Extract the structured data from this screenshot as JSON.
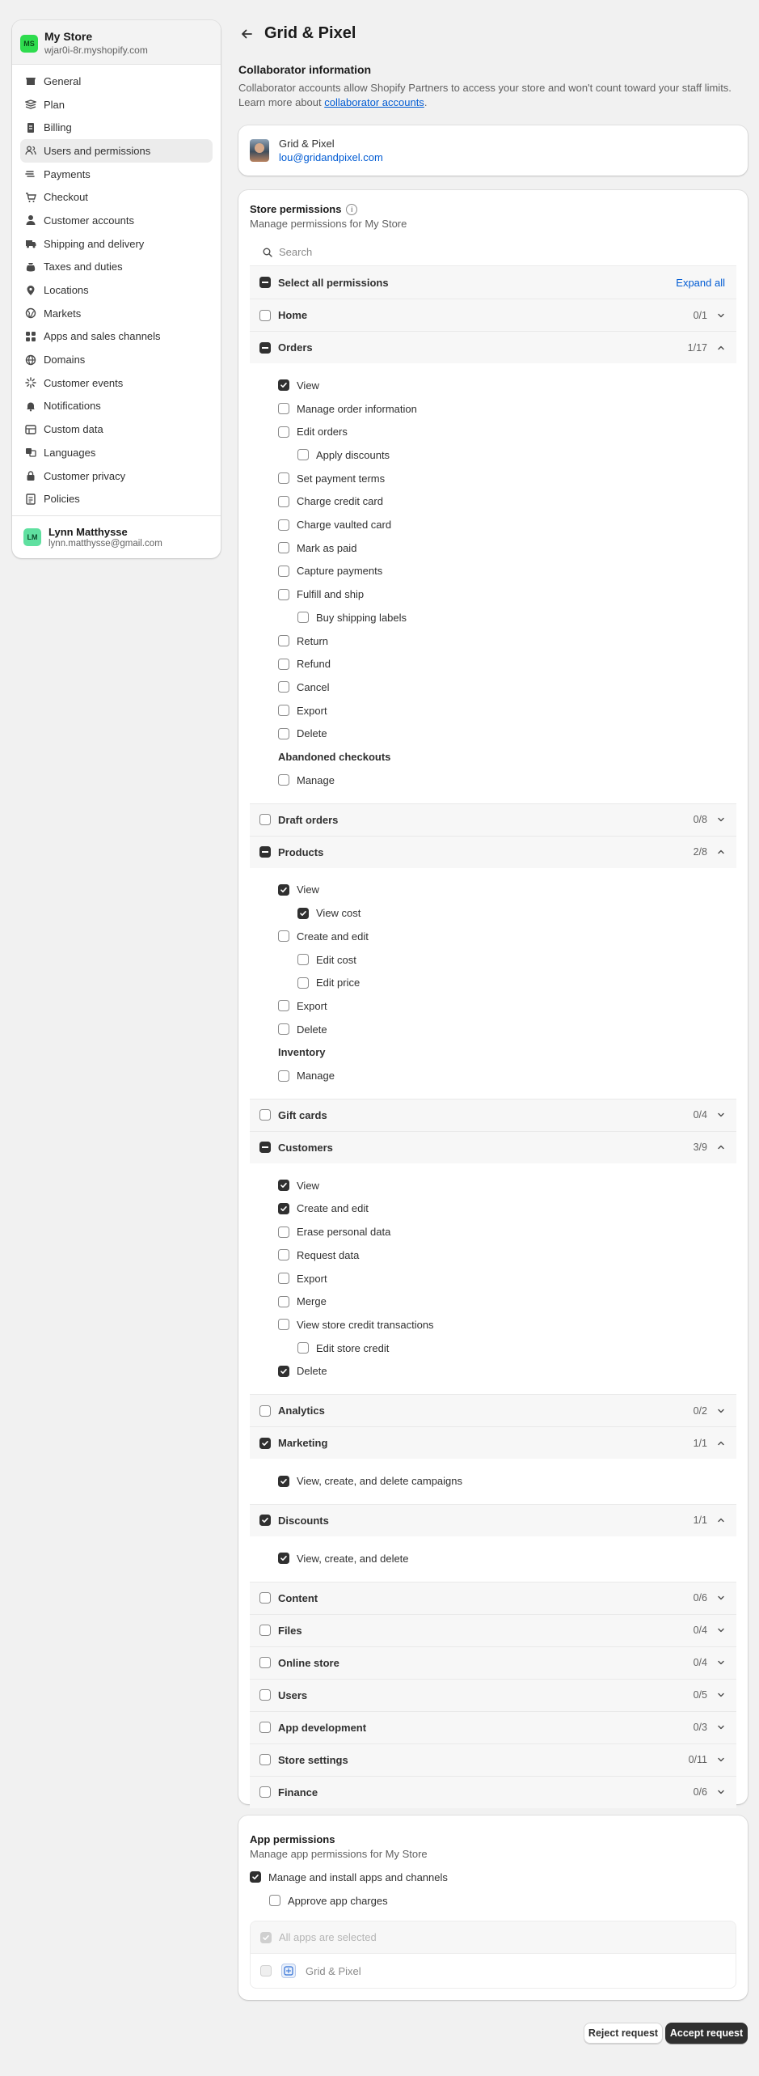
{
  "store": {
    "initials": "MS",
    "name": "My Store",
    "domain": "wjar0i-8r.myshopify.com"
  },
  "sidebar": {
    "items": [
      {
        "label": "General",
        "icon": "store-icon"
      },
      {
        "label": "Plan",
        "icon": "plan-icon"
      },
      {
        "label": "Billing",
        "icon": "billing-icon"
      },
      {
        "label": "Users and permissions",
        "icon": "users-icon"
      },
      {
        "label": "Payments",
        "icon": "payments-icon"
      },
      {
        "label": "Checkout",
        "icon": "cart-icon"
      },
      {
        "label": "Customer accounts",
        "icon": "person-icon"
      },
      {
        "label": "Shipping and delivery",
        "icon": "truck-icon"
      },
      {
        "label": "Taxes and duties",
        "icon": "tax-icon"
      },
      {
        "label": "Locations",
        "icon": "location-icon"
      },
      {
        "label": "Markets",
        "icon": "globe-icon"
      },
      {
        "label": "Apps and sales channels",
        "icon": "apps-icon"
      },
      {
        "label": "Domains",
        "icon": "domain-icon"
      },
      {
        "label": "Customer events",
        "icon": "events-icon"
      },
      {
        "label": "Notifications",
        "icon": "bell-icon"
      },
      {
        "label": "Custom data",
        "icon": "data-icon"
      },
      {
        "label": "Languages",
        "icon": "language-icon"
      },
      {
        "label": "Customer privacy",
        "icon": "lock-icon"
      },
      {
        "label": "Policies",
        "icon": "policies-icon"
      }
    ],
    "active": "Users and permissions"
  },
  "user": {
    "initials": "LM",
    "name": "Lynn Matthysse",
    "email": "lynn.matthysse@gmail.com"
  },
  "page": {
    "title": "Grid & Pixel"
  },
  "collaborator": {
    "heading": "Collaborator information",
    "desc_1": "Collaborator accounts allow Shopify Partners to access your store and won't count toward your staff limits. Learn more about ",
    "link": "collaborator accounts",
    "desc_2": ".",
    "partner_name": "Grid & Pixel",
    "partner_email": "lou@gridandpixel.com"
  },
  "store_permissions": {
    "title": "Store permissions",
    "subtitle": "Manage permissions for My Store",
    "search_placeholder": "Search",
    "select_all": "Select all permissions",
    "expand_all": "Expand all",
    "groups": [
      {
        "label": "Home",
        "count": "0/1",
        "state": "off",
        "expanded": false
      },
      {
        "label": "Orders",
        "count": "1/17",
        "state": "mixed",
        "expanded": true,
        "items": [
          {
            "label": "View",
            "checked": true,
            "indent": 0
          },
          {
            "label": "Manage order information",
            "checked": false,
            "indent": 0
          },
          {
            "label": "Edit orders",
            "checked": false,
            "indent": 0
          },
          {
            "label": "Apply discounts",
            "checked": false,
            "indent": 1
          },
          {
            "label": "Set payment terms",
            "checked": false,
            "indent": 0
          },
          {
            "label": "Charge credit card",
            "checked": false,
            "indent": 0
          },
          {
            "label": "Charge vaulted card",
            "checked": false,
            "indent": 0
          },
          {
            "label": "Mark as paid",
            "checked": false,
            "indent": 0
          },
          {
            "label": "Capture payments",
            "checked": false,
            "indent": 0
          },
          {
            "label": "Fulfill and ship",
            "checked": false,
            "indent": 0
          },
          {
            "label": "Buy shipping labels",
            "checked": false,
            "indent": 1
          },
          {
            "label": "Return",
            "checked": false,
            "indent": 0
          },
          {
            "label": "Refund",
            "checked": false,
            "indent": 0
          },
          {
            "label": "Cancel",
            "checked": false,
            "indent": 0
          },
          {
            "label": "Export",
            "checked": false,
            "indent": 0
          },
          {
            "label": "Delete",
            "checked": false,
            "indent": 0
          },
          {
            "heading": "Abandoned checkouts"
          },
          {
            "label": "Manage",
            "checked": false,
            "indent": 0
          }
        ]
      },
      {
        "label": "Draft orders",
        "count": "0/8",
        "state": "off",
        "expanded": false
      },
      {
        "label": "Products",
        "count": "2/8",
        "state": "mixed",
        "expanded": true,
        "items": [
          {
            "label": "View",
            "checked": true,
            "indent": 0
          },
          {
            "label": "View cost",
            "checked": true,
            "indent": 1
          },
          {
            "label": "Create and edit",
            "checked": false,
            "indent": 0
          },
          {
            "label": "Edit cost",
            "checked": false,
            "indent": 1
          },
          {
            "label": "Edit price",
            "checked": false,
            "indent": 1
          },
          {
            "label": "Export",
            "checked": false,
            "indent": 0
          },
          {
            "label": "Delete",
            "checked": false,
            "indent": 0
          },
          {
            "heading": "Inventory"
          },
          {
            "label": "Manage",
            "checked": false,
            "indent": 0
          }
        ]
      },
      {
        "label": "Gift cards",
        "count": "0/4",
        "state": "off",
        "expanded": false
      },
      {
        "label": "Customers",
        "count": "3/9",
        "state": "mixed",
        "expanded": true,
        "items": [
          {
            "label": "View",
            "checked": true,
            "indent": 0
          },
          {
            "label": "Create and edit",
            "checked": true,
            "indent": 0
          },
          {
            "label": "Erase personal data",
            "checked": false,
            "indent": 0
          },
          {
            "label": "Request data",
            "checked": false,
            "indent": 0
          },
          {
            "label": "Export",
            "checked": false,
            "indent": 0
          },
          {
            "label": "Merge",
            "checked": false,
            "indent": 0
          },
          {
            "label": "View store credit transactions",
            "checked": false,
            "indent": 0
          },
          {
            "label": "Edit store credit",
            "checked": false,
            "indent": 1
          },
          {
            "label": "Delete",
            "checked": true,
            "indent": 0
          }
        ]
      },
      {
        "label": "Analytics",
        "count": "0/2",
        "state": "off",
        "expanded": false
      },
      {
        "label": "Marketing",
        "count": "1/1",
        "state": "on",
        "expanded": true,
        "items": [
          {
            "label": "View, create, and delete campaigns",
            "checked": true,
            "indent": 0
          }
        ]
      },
      {
        "label": "Discounts",
        "count": "1/1",
        "state": "on",
        "expanded": true,
        "items": [
          {
            "label": "View, create, and delete",
            "checked": true,
            "indent": 0
          }
        ]
      },
      {
        "label": "Content",
        "count": "0/6",
        "state": "off",
        "expanded": false
      },
      {
        "label": "Files",
        "count": "0/4",
        "state": "off",
        "expanded": false
      },
      {
        "label": "Online store",
        "count": "0/4",
        "state": "off",
        "expanded": false
      },
      {
        "label": "Users",
        "count": "0/5",
        "state": "off",
        "expanded": false
      },
      {
        "label": "App development",
        "count": "0/3",
        "state": "off",
        "expanded": false
      },
      {
        "label": "Store settings",
        "count": "0/11",
        "state": "off",
        "expanded": false
      },
      {
        "label": "Finance",
        "count": "0/6",
        "state": "off",
        "expanded": false
      }
    ]
  },
  "app_permissions": {
    "title": "App permissions",
    "subtitle": "Manage app permissions for My Store",
    "manage_label": "Manage and install apps and channels",
    "approve_label": "Approve app charges",
    "all_apps_label": "All apps are selected",
    "app_name": "Grid & Pixel"
  },
  "actions": {
    "reject": "Reject request",
    "accept": "Accept request"
  }
}
